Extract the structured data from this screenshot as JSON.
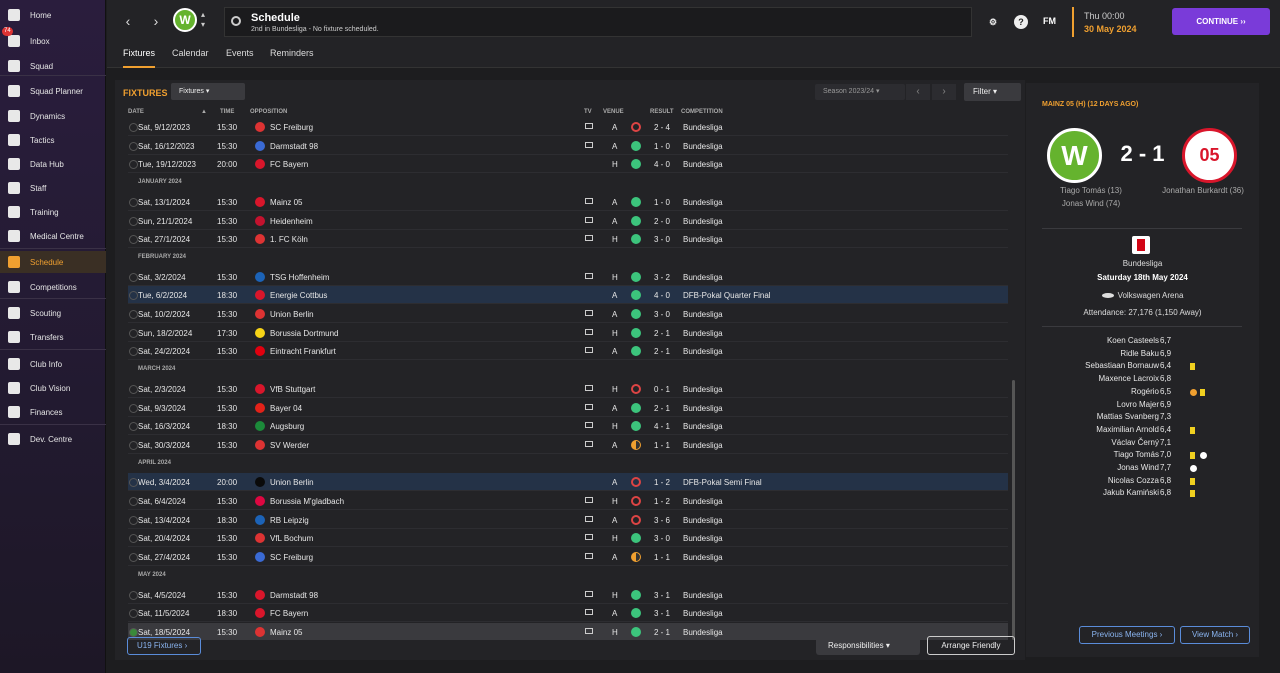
{
  "sidebar": {
    "inbox_badge": "74",
    "items": [
      {
        "label": "Home",
        "icon": "home-icon"
      },
      {
        "label": "Inbox",
        "icon": "inbox-icon"
      },
      {
        "label": "Squad",
        "icon": "shirt-icon"
      },
      {
        "label": "Squad Planner",
        "icon": "planner-icon"
      },
      {
        "label": "Dynamics",
        "icon": "dynamics-icon"
      },
      {
        "label": "Tactics",
        "icon": "tactics-icon"
      },
      {
        "label": "Data Hub",
        "icon": "data-hub-icon"
      },
      {
        "label": "Staff",
        "icon": "staff-icon"
      },
      {
        "label": "Training",
        "icon": "training-icon"
      },
      {
        "label": "Medical Centre",
        "icon": "medical-icon"
      },
      {
        "label": "Schedule",
        "icon": "calendar-icon"
      },
      {
        "label": "Competitions",
        "icon": "trophy-icon"
      },
      {
        "label": "Scouting",
        "icon": "scouting-icon"
      },
      {
        "label": "Transfers",
        "icon": "transfers-icon"
      },
      {
        "label": "Club Info",
        "icon": "shield-icon"
      },
      {
        "label": "Club Vision",
        "icon": "vision-icon"
      },
      {
        "label": "Finances",
        "icon": "finances-icon"
      },
      {
        "label": "Dev. Centre",
        "icon": "dev-centre-icon"
      }
    ]
  },
  "topbar": {
    "title": "Schedule",
    "subtitle": "2nd in Bundesliga - No fixture scheduled.",
    "fm_label": "FM",
    "help_label": "?",
    "date_day": "Thu 00:00",
    "date_full": "30 May 2024",
    "continue_label": "CONTINUE ››"
  },
  "subtabs": [
    "Fixtures",
    "Calendar",
    "Events",
    "Reminders"
  ],
  "fixtures": {
    "title": "FIXTURES",
    "dropdown": "Fixtures",
    "season": "Season 2023/24",
    "filter": "Filter",
    "columns": {
      "date": "DATE",
      "time": "TIME",
      "opposition": "OPPOSITION",
      "tv": "TV",
      "venue": "VENUE",
      "result": "RESULT",
      "competition": "COMPETITION"
    },
    "rows": [
      {
        "type": "match",
        "date": "Sat, 9/12/2023",
        "time": "15:30",
        "opp": "SC Freiburg",
        "tv": true,
        "venue": "A",
        "outcome": "L",
        "score": "2 - 4",
        "comp": "Bundesliga"
      },
      {
        "type": "match",
        "date": "Sat, 16/12/2023",
        "time": "15:30",
        "opp": "Darmstadt 98",
        "tv": true,
        "venue": "A",
        "outcome": "W",
        "score": "1 - 0",
        "comp": "Bundesliga"
      },
      {
        "type": "match",
        "date": "Tue, 19/12/2023",
        "time": "20:00",
        "opp": "FC Bayern",
        "tv": false,
        "venue": "H",
        "outcome": "W",
        "score": "4 - 0",
        "comp": "Bundesliga"
      },
      {
        "type": "month",
        "label": "JANUARY 2024"
      },
      {
        "type": "match",
        "date": "Sat, 13/1/2024",
        "time": "15:30",
        "opp": "Mainz 05",
        "tv": true,
        "venue": "A",
        "outcome": "W",
        "score": "1 - 0",
        "comp": "Bundesliga"
      },
      {
        "type": "match",
        "date": "Sun, 21/1/2024",
        "time": "15:30",
        "opp": "Heidenheim",
        "tv": true,
        "venue": "A",
        "outcome": "W",
        "score": "2 - 0",
        "comp": "Bundesliga"
      },
      {
        "type": "match",
        "date": "Sat, 27/1/2024",
        "time": "15:30",
        "opp": "1. FC Köln",
        "tv": true,
        "venue": "H",
        "outcome": "W",
        "score": "3 - 0",
        "comp": "Bundesliga"
      },
      {
        "type": "month",
        "label": "FEBRUARY 2024"
      },
      {
        "type": "match",
        "date": "Sat, 3/2/2024",
        "time": "15:30",
        "opp": "TSG Hoffenheim",
        "tv": true,
        "venue": "H",
        "outcome": "W",
        "score": "3 - 2",
        "comp": "Bundesliga"
      },
      {
        "type": "match",
        "date": "Tue, 6/2/2024",
        "time": "18:30",
        "opp": "Energie Cottbus",
        "tv": false,
        "venue": "A",
        "outcome": "W",
        "score": "4 - 0",
        "comp": "DFB-Pokal Quarter Final",
        "highlight": true
      },
      {
        "type": "match",
        "date": "Sat, 10/2/2024",
        "time": "15:30",
        "opp": "Union Berlin",
        "tv": true,
        "venue": "A",
        "outcome": "W",
        "score": "3 - 0",
        "comp": "Bundesliga"
      },
      {
        "type": "match",
        "date": "Sun, 18/2/2024",
        "time": "17:30",
        "opp": "Borussia Dortmund",
        "tv": true,
        "venue": "H",
        "outcome": "W",
        "score": "2 - 1",
        "comp": "Bundesliga"
      },
      {
        "type": "match",
        "date": "Sat, 24/2/2024",
        "time": "15:30",
        "opp": "Eintracht Frankfurt",
        "tv": true,
        "venue": "A",
        "outcome": "W",
        "score": "2 - 1",
        "comp": "Bundesliga"
      },
      {
        "type": "month",
        "label": "MARCH 2024"
      },
      {
        "type": "match",
        "date": "Sat, 2/3/2024",
        "time": "15:30",
        "opp": "VfB Stuttgart",
        "tv": true,
        "venue": "H",
        "outcome": "L",
        "score": "0 - 1",
        "comp": "Bundesliga"
      },
      {
        "type": "match",
        "date": "Sat, 9/3/2024",
        "time": "15:30",
        "opp": "Bayer 04",
        "tv": true,
        "venue": "A",
        "outcome": "W",
        "score": "2 - 1",
        "comp": "Bundesliga"
      },
      {
        "type": "match",
        "date": "Sat, 16/3/2024",
        "time": "18:30",
        "opp": "Augsburg",
        "tv": true,
        "venue": "H",
        "outcome": "W",
        "score": "4 - 1",
        "comp": "Bundesliga"
      },
      {
        "type": "match",
        "date": "Sat, 30/3/2024",
        "time": "15:30",
        "opp": "SV Werder",
        "tv": true,
        "venue": "A",
        "outcome": "D",
        "score": "1 - 1",
        "comp": "Bundesliga"
      },
      {
        "type": "month",
        "label": "APRIL 2024"
      },
      {
        "type": "match",
        "date": "Wed, 3/4/2024",
        "time": "20:00",
        "opp": "Union Berlin",
        "tv": false,
        "venue": "A",
        "outcome": "L",
        "score": "1 - 2",
        "comp": "DFB-Pokal Semi Final",
        "highlight": true
      },
      {
        "type": "match",
        "date": "Sat, 6/4/2024",
        "time": "15:30",
        "opp": "Borussia M'gladbach",
        "tv": true,
        "venue": "H",
        "outcome": "L",
        "score": "1 - 2",
        "comp": "Bundesliga"
      },
      {
        "type": "match",
        "date": "Sat, 13/4/2024",
        "time": "18:30",
        "opp": "RB Leipzig",
        "tv": true,
        "venue": "A",
        "outcome": "L",
        "score": "3 - 6",
        "comp": "Bundesliga"
      },
      {
        "type": "match",
        "date": "Sat, 20/4/2024",
        "time": "15:30",
        "opp": "VfL Bochum",
        "tv": true,
        "venue": "H",
        "outcome": "W",
        "score": "3 - 0",
        "comp": "Bundesliga"
      },
      {
        "type": "match",
        "date": "Sat, 27/4/2024",
        "time": "15:30",
        "opp": "SC Freiburg",
        "tv": true,
        "venue": "A",
        "outcome": "D",
        "score": "1 - 1",
        "comp": "Bundesliga"
      },
      {
        "type": "month",
        "label": "MAY 2024"
      },
      {
        "type": "match",
        "date": "Sat, 4/5/2024",
        "time": "15:30",
        "opp": "Darmstadt 98",
        "tv": true,
        "venue": "H",
        "outcome": "W",
        "score": "3 - 1",
        "comp": "Bundesliga"
      },
      {
        "type": "match",
        "date": "Sat, 11/5/2024",
        "time": "18:30",
        "opp": "FC Bayern",
        "tv": true,
        "venue": "A",
        "outcome": "W",
        "score": "3 - 1",
        "comp": "Bundesliga"
      },
      {
        "type": "match",
        "date": "Sat, 18/5/2024",
        "time": "15:30",
        "opp": "Mainz 05",
        "tv": true,
        "venue": "H",
        "outcome": "W",
        "score": "2 - 1",
        "comp": "Bundesliga",
        "selected": true
      }
    ],
    "u19_label": "U19 Fixtures ›",
    "responsibilities_label": "Responsibilities",
    "arrange_label": "Arrange Friendly"
  },
  "match": {
    "title": "MAINZ 05 (H) (12 DAYS AGO)",
    "score": "2 - 1",
    "home_scorers": [
      "Tiago Tomás (13)",
      "Jonas Wind (74)"
    ],
    "away_scorers": [
      "Jonathan Burkardt (36)"
    ],
    "competition": "Bundesliga",
    "date": "Saturday 18th May 2024",
    "stadium": "Volkswagen Arena",
    "attendance": "Attendance: 27,176 (1,150 Away)",
    "ratings": [
      {
        "name": "Koen Casteels",
        "rating": "6,7",
        "yellow": false,
        "goal": false,
        "own": false
      },
      {
        "name": "Ridle Baku",
        "rating": "6,9",
        "yellow": false,
        "goal": false,
        "own": false
      },
      {
        "name": "Sebastiaan Bornauw",
        "rating": "6,4",
        "yellow": true,
        "goal": false,
        "own": false
      },
      {
        "name": "Maxence Lacroix",
        "rating": "6,8",
        "yellow": false,
        "goal": false,
        "own": false
      },
      {
        "name": "Rogério",
        "rating": "6,5",
        "yellow": true,
        "goal": false,
        "own": true
      },
      {
        "name": "Lovro Majer",
        "rating": "6,9",
        "yellow": false,
        "goal": false,
        "own": false
      },
      {
        "name": "Mattias Svanberg",
        "rating": "7,3",
        "yellow": false,
        "goal": false,
        "own": false
      },
      {
        "name": "Maximilian Arnold",
        "rating": "6,4",
        "yellow": true,
        "goal": false,
        "own": false
      },
      {
        "name": "Václav Černý",
        "rating": "7,1",
        "yellow": false,
        "goal": false,
        "own": false
      },
      {
        "name": "Tiago Tomás",
        "rating": "7,0",
        "yellow": true,
        "goal": true,
        "own": false
      },
      {
        "name": "Jonas Wind",
        "rating": "7,7",
        "yellow": false,
        "goal": true,
        "own": false
      },
      {
        "name": "Nicolas Cozza",
        "rating": "6,8",
        "yellow": true,
        "goal": false,
        "own": false
      },
      {
        "name": "Jakub Kamiński",
        "rating": "6,8",
        "yellow": true,
        "goal": false,
        "own": false
      }
    ],
    "prev_label": "Previous Meetings ›",
    "view_label": "View Match ›"
  },
  "colors": {
    "accent": "#f0a030",
    "continue": "#7a3bd9",
    "win": "#3cc47c",
    "loss": "#dd4444"
  }
}
